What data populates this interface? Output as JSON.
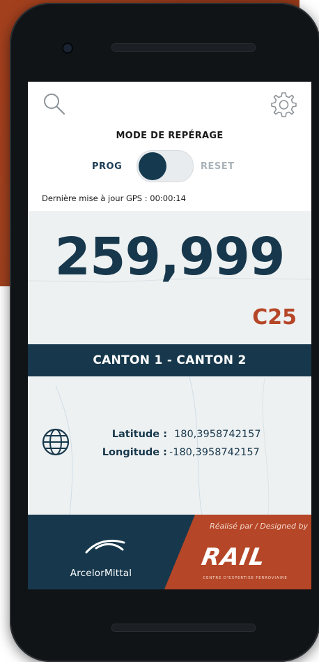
{
  "header": {
    "mode_title": "MODE DE REPÉRAGE",
    "toggle_left_label": "PROG",
    "toggle_right_label": "RESET",
    "toggle_state": "PROG",
    "gps_update": "Dernière mise à jour GPS : 00:00:14"
  },
  "position": {
    "pk": "259,999",
    "track": "C25",
    "canton": "CANTON 1 - CANTON 2"
  },
  "coordinates": {
    "latitude_label": "Latitude :",
    "latitude_value": "180,3958742157",
    "longitude_label": "Longitude :",
    "longitude_value": "-180,3958742157"
  },
  "footer": {
    "client_name": "ArcelorMittal",
    "designed_by": "Réalisé par / Designed by",
    "rail_logo": "RAIL",
    "rail_subtitle": "CENTRE D'EXPERTISE FERROVIAIRE"
  },
  "icons": {
    "search": "search-icon",
    "settings": "gear-icon",
    "globe": "globe-icon"
  },
  "colors": {
    "primary": "#17384c",
    "accent": "#b54627",
    "map_bg": "#eef1f2"
  }
}
